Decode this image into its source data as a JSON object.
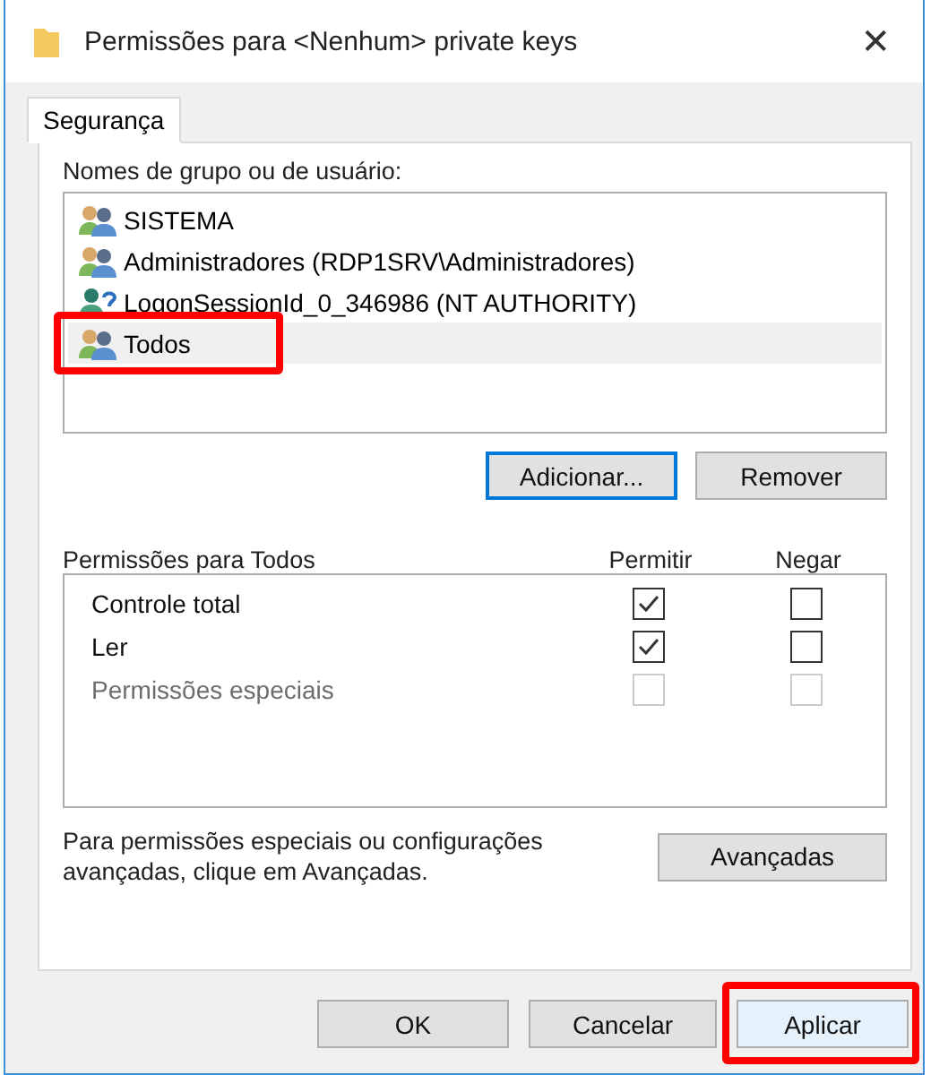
{
  "window": {
    "title": "Permissões para <Nenhum> private keys",
    "close": "✕"
  },
  "tabs": [
    {
      "label": "Segurança",
      "selected": true
    }
  ],
  "users": {
    "label": "Nomes de grupo ou de usuário:",
    "items": [
      {
        "name": "SISTEMA",
        "kind": "group",
        "selected": false,
        "annotated": false
      },
      {
        "name": "Administradores (RDP1SRV\\Administradores)",
        "kind": "group",
        "selected": false,
        "annotated": false
      },
      {
        "name": "LogonSessionId_0_346986 (NT AUTHORITY)",
        "kind": "unknown",
        "selected": false,
        "annotated": false
      },
      {
        "name": "Todos",
        "kind": "group",
        "selected": true,
        "annotated": true
      }
    ],
    "buttons": [
      {
        "label": "Adicionar...",
        "focused": true
      },
      {
        "label": "Remover",
        "focused": false
      }
    ]
  },
  "permissions": {
    "title": "Permissões para Todos",
    "allow_label": "Permitir",
    "deny_label": "Negar",
    "rows": [
      {
        "name": "Controle total",
        "allow": true,
        "deny": false,
        "disabled": false
      },
      {
        "name": "Ler",
        "allow": true,
        "deny": false,
        "disabled": false
      },
      {
        "name": "Permissões especiais",
        "allow": false,
        "deny": false,
        "disabled": true
      }
    ]
  },
  "advanced": {
    "text": "Para permissões especiais ou configurações avançadas, clique em Avançadas.",
    "button": "Avançadas"
  },
  "footer": [
    {
      "label": "OK",
      "annotated": false
    },
    {
      "label": "Cancelar",
      "annotated": false
    },
    {
      "label": "Aplicar",
      "annotated": true
    }
  ]
}
